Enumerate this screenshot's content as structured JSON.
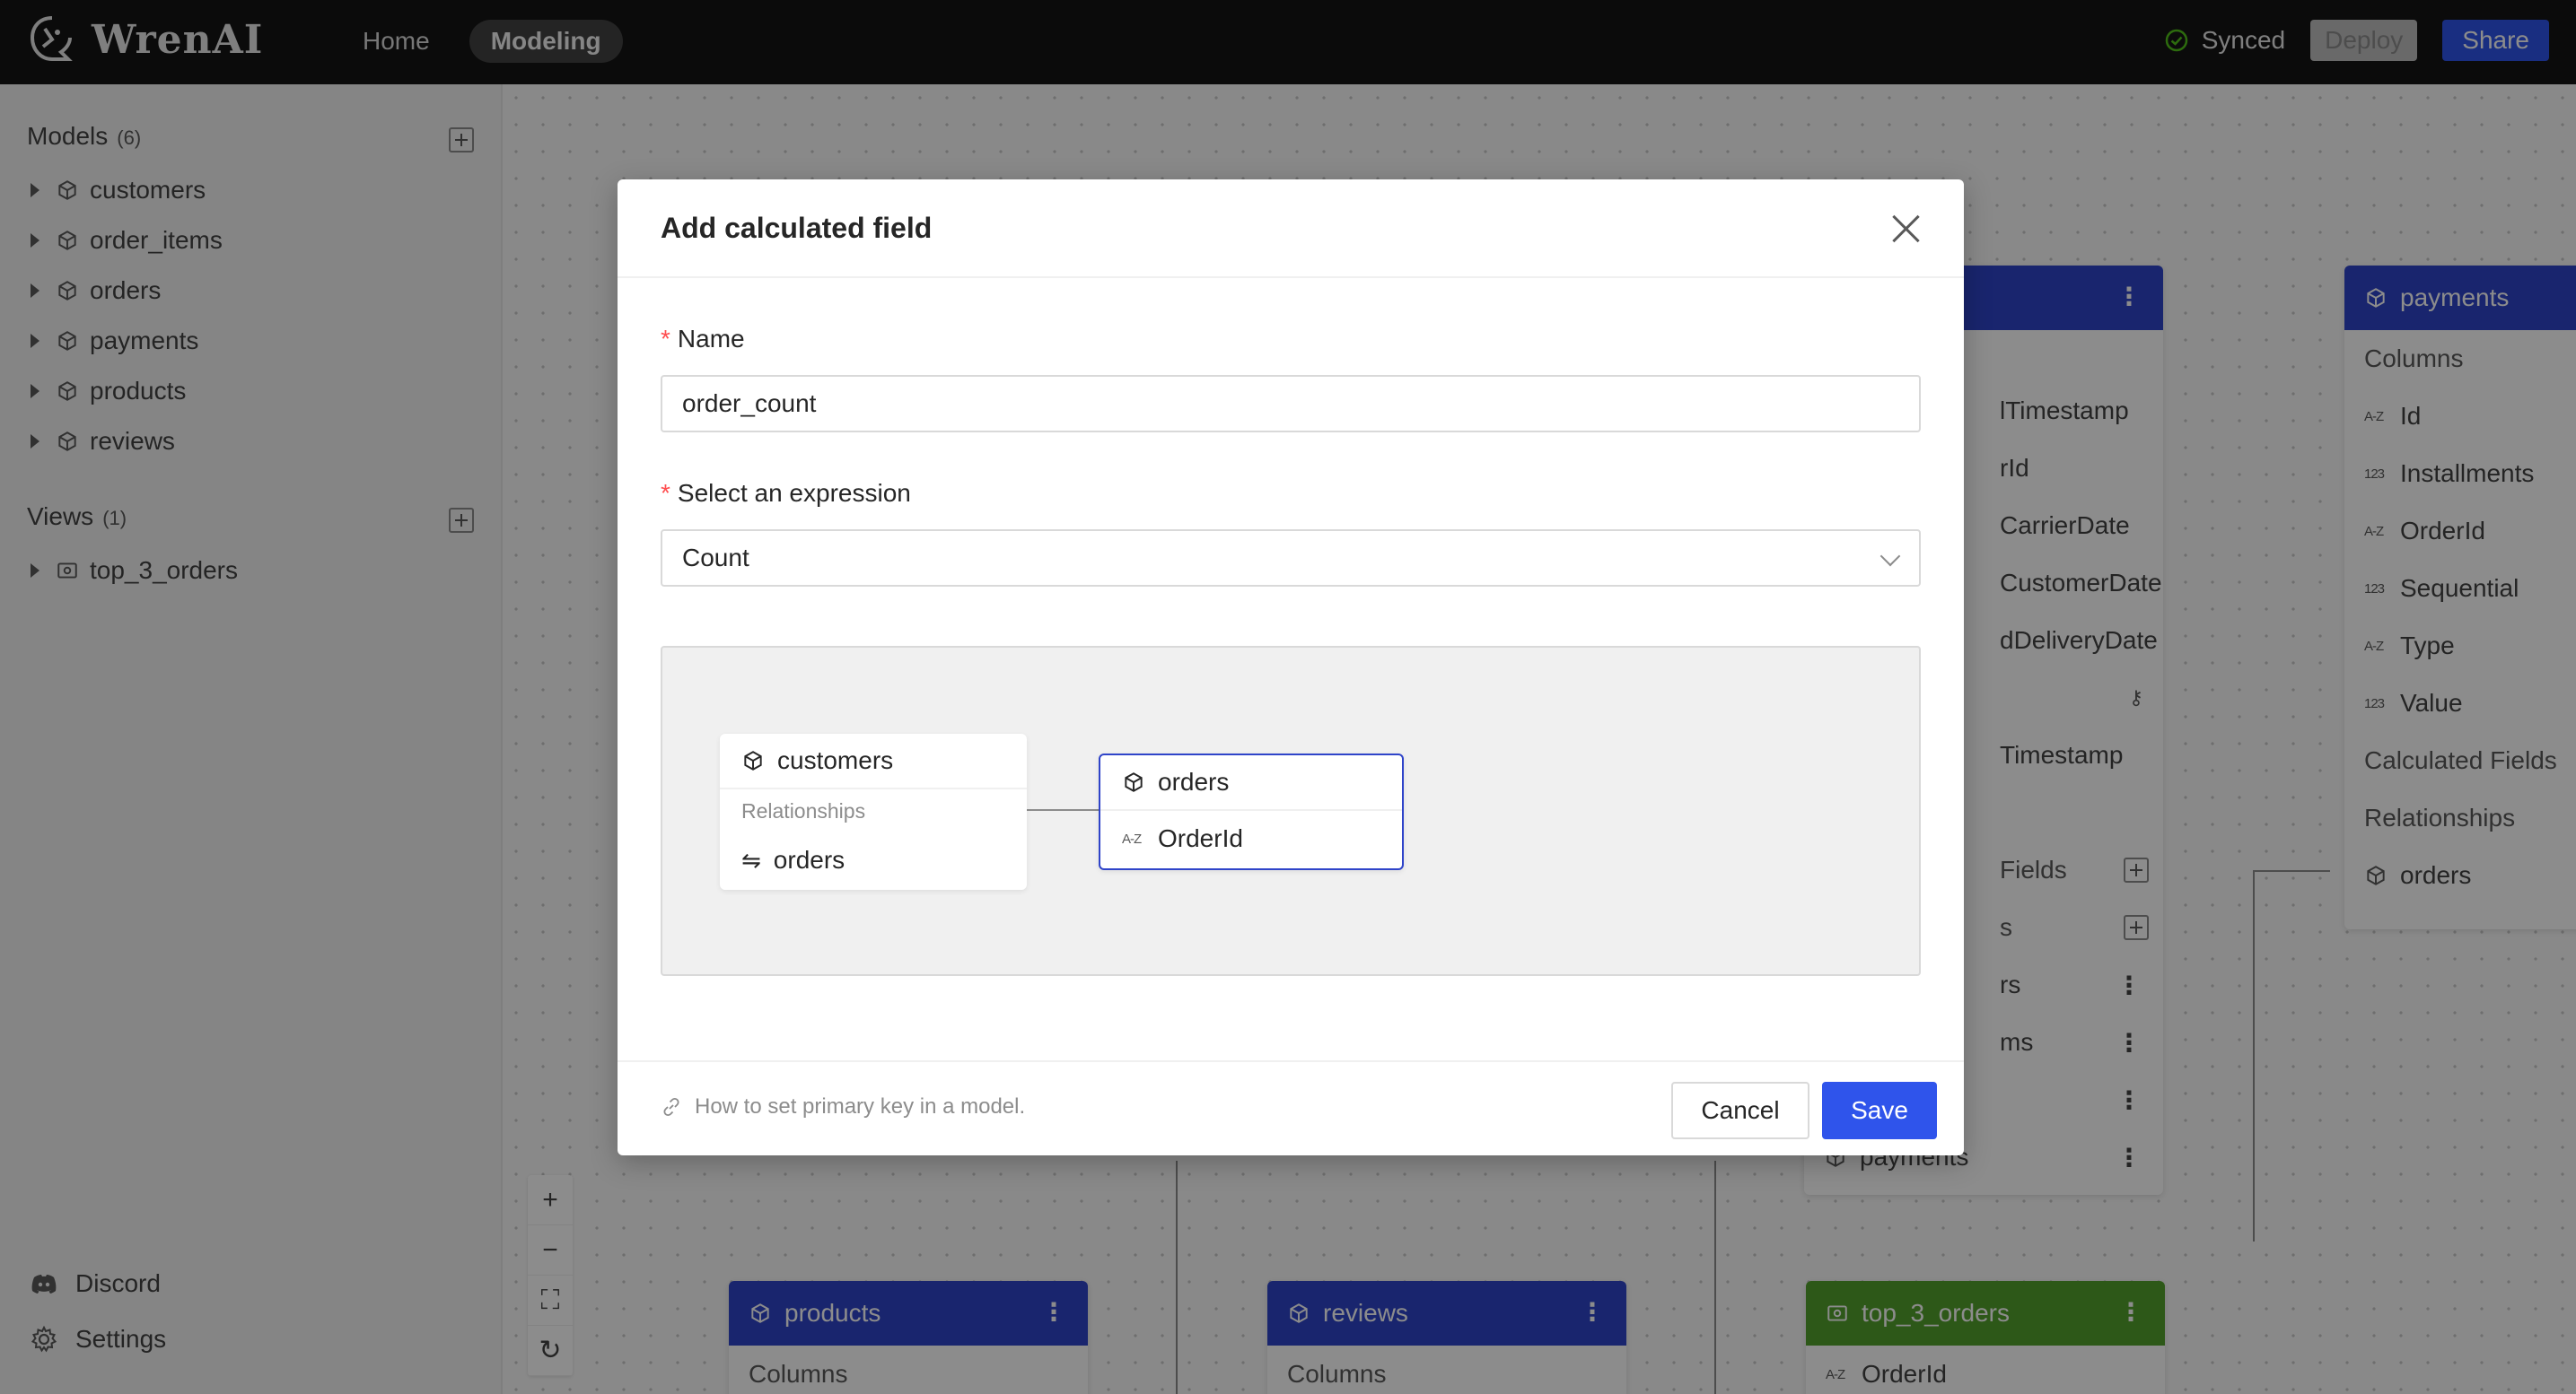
{
  "app": {
    "logo_text": "WrenAI"
  },
  "nav": {
    "home": "Home",
    "modeling": "Modeling"
  },
  "header": {
    "sync_status": "Synced",
    "deploy_label": "Deploy",
    "share_label": "Share"
  },
  "sidebar": {
    "models_title": "Models",
    "models_count": "(6)",
    "models": [
      "customers",
      "order_items",
      "orders",
      "payments",
      "products",
      "reviews"
    ],
    "views_title": "Views",
    "views_count": "(1)",
    "views": [
      "top_3_orders"
    ],
    "discord": "Discord",
    "settings": "Settings"
  },
  "canvas": {
    "orders_node_rows": [
      "lTimestamp",
      "rId",
      "CarrierDate",
      "CustomerDate",
      "dDeliveryDate",
      "",
      "Timestamp",
      "",
      "Fields",
      "s",
      "rs",
      "ms",
      "",
      "payments"
    ],
    "payments_node": {
      "title": "payments",
      "columns_label": "Columns",
      "fields": [
        {
          "type": "A-Z",
          "name": "Id"
        },
        {
          "type": "123",
          "name": "Installments"
        },
        {
          "type": "A-Z",
          "name": "OrderId"
        },
        {
          "type": "123",
          "name": "Sequential"
        },
        {
          "type": "A-Z",
          "name": "Type"
        },
        {
          "type": "123",
          "name": "Value"
        }
      ],
      "calculated_label": "Calculated Fields",
      "relationships_label": "Relationships",
      "relation": "orders"
    },
    "products_node": {
      "title": "products",
      "columns_label": "Columns"
    },
    "reviews_node": {
      "title": "reviews",
      "columns_label": "Columns"
    },
    "top3_node": {
      "title": "top_3_orders",
      "field": "OrderId",
      "field_type": "A-Z"
    }
  },
  "modal": {
    "title": "Add calculated field",
    "name_label": "Name",
    "name_value": "order_count",
    "expression_label": "Select an expression",
    "expression_value": "Count",
    "preview": {
      "source_model": "customers",
      "relationships_label": "Relationships",
      "relation": "orders",
      "target_model": "orders",
      "target_field": "OrderId",
      "target_field_type": "A-Z"
    },
    "help_link": "How to set primary key in a model.",
    "cancel_label": "Cancel",
    "save_label": "Save"
  },
  "colors": {
    "primary": "#2f54eb",
    "header_bg": "#141414",
    "view_green": "#52a02c"
  }
}
